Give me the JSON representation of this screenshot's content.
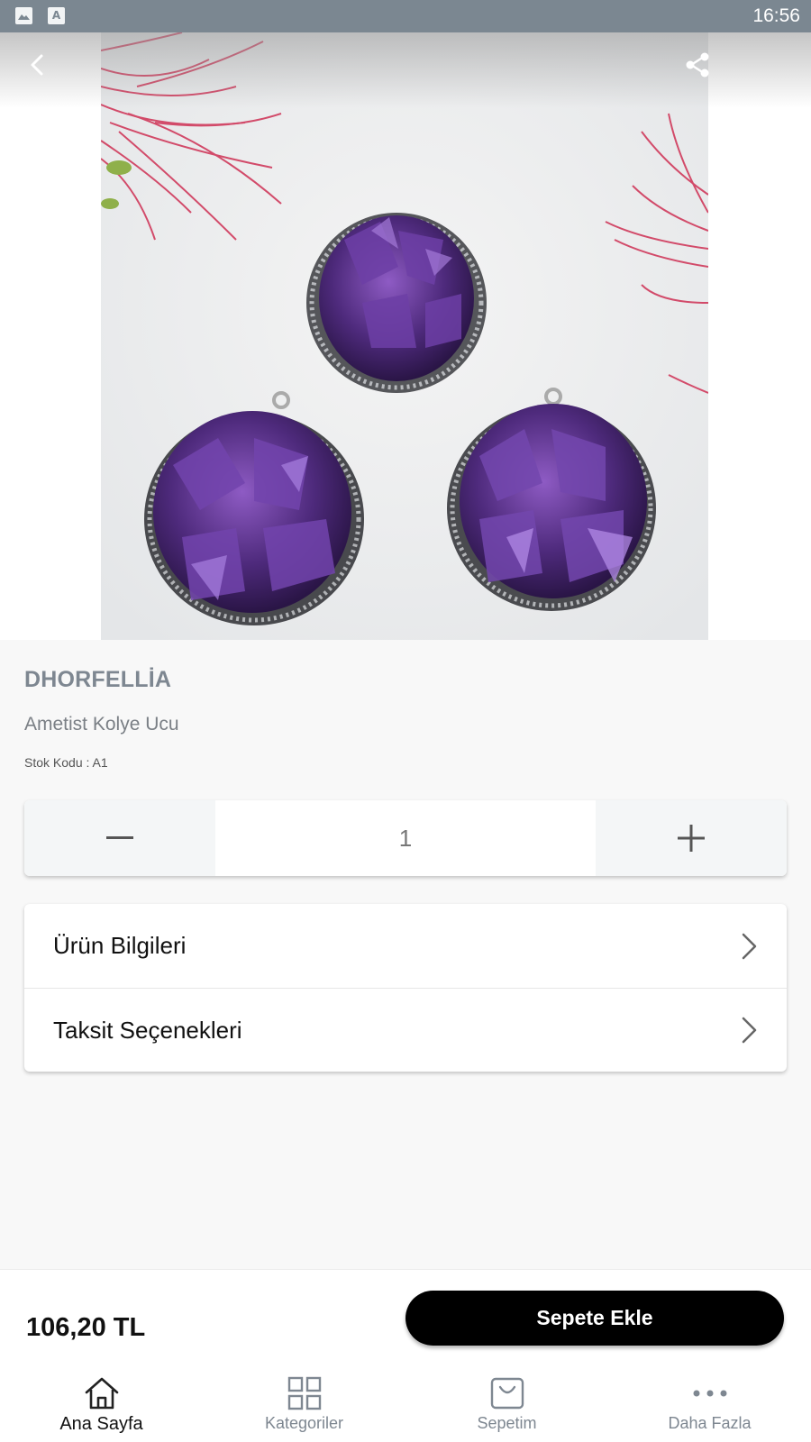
{
  "status_bar": {
    "time": "16:56",
    "icons": [
      "image-notification-icon",
      "a-notification-icon"
    ]
  },
  "hero": {
    "image_label": "Product photo",
    "back_icon": "chevron-left-icon",
    "share_icon": "share-icon"
  },
  "product": {
    "brand": "DHORFELLİA",
    "name": "Ametist Kolye Ucu",
    "stock_code": "Stok Kodu : A1"
  },
  "quantity": {
    "value": "1",
    "decrease_icon": "minus-icon",
    "increase_icon": "plus-icon"
  },
  "info_rows": [
    {
      "label": "Ürün Bilgileri",
      "icon": "chevron-right-icon"
    },
    {
      "label": "Taksit Seçenekleri",
      "icon": "chevron-right-icon"
    }
  ],
  "purchase": {
    "price": "106,20 TL",
    "add_to_cart_label": "Sepete Ekle"
  },
  "nav": {
    "items": [
      {
        "label": "Ana Sayfa",
        "icon": "home-icon",
        "active": true
      },
      {
        "label": "Kategoriler",
        "icon": "grid-icon",
        "active": false
      },
      {
        "label": "Sepetim",
        "icon": "shopping-bag-icon",
        "active": false
      },
      {
        "label": "Daha Fazla",
        "icon": "more-dots-icon",
        "active": false
      }
    ]
  },
  "colors": {
    "status_bar": "#7b8791",
    "muted_text": "#7e8791",
    "button": "#000000",
    "background": "#f8f8f8"
  }
}
